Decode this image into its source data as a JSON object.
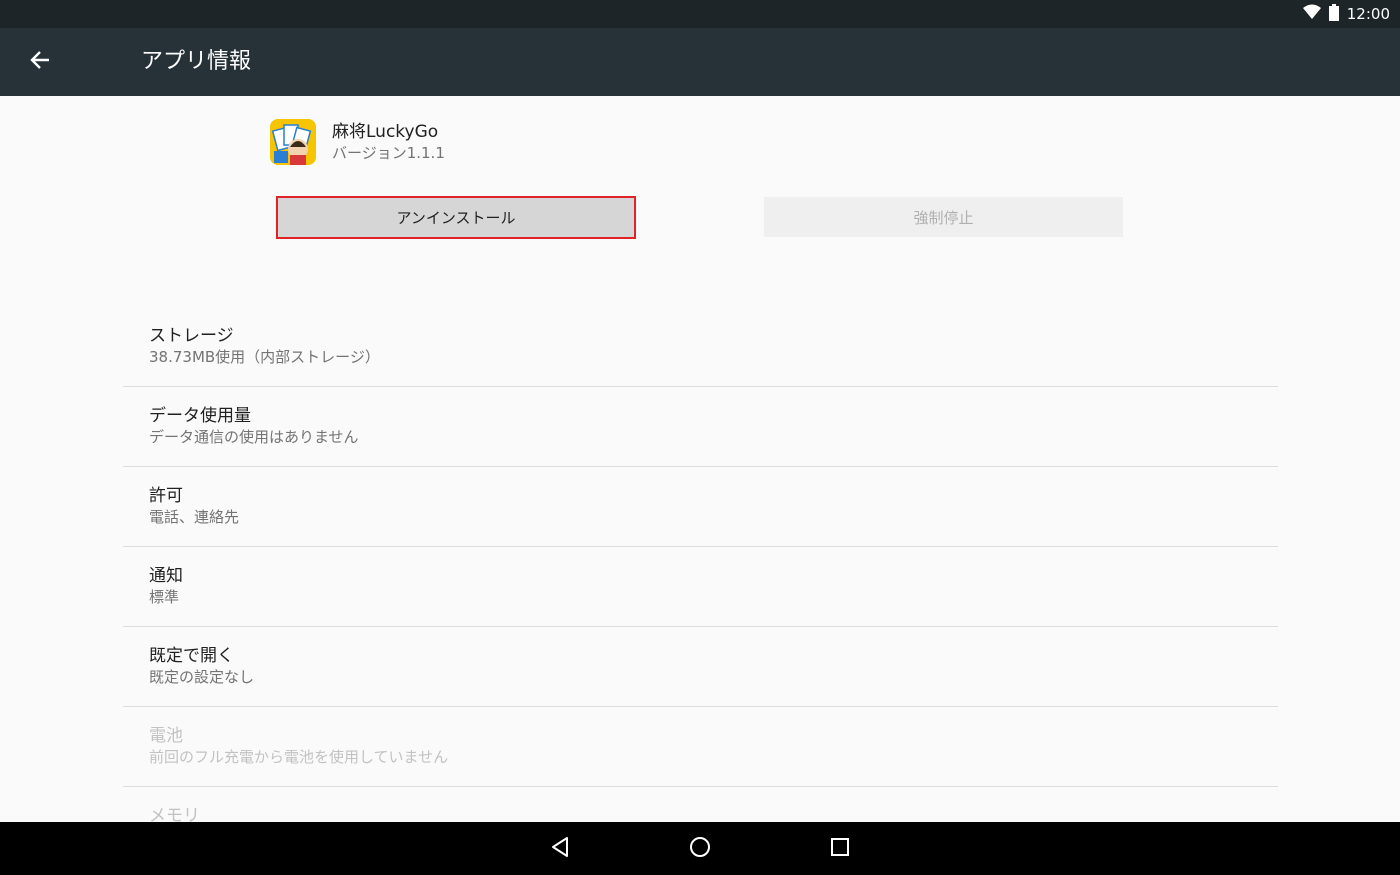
{
  "status_bar": {
    "time": "12:00",
    "icons": [
      "wifi-icon",
      "battery-icon"
    ]
  },
  "app_bar": {
    "back_icon": "arrow-left-icon",
    "title": "アプリ情報"
  },
  "app": {
    "name": "麻将LuckyGo",
    "version": "バージョン1.1.1"
  },
  "buttons": {
    "uninstall": "アンインストール",
    "force_stop": "強制停止"
  },
  "settings": [
    {
      "title": "ストレージ",
      "subtitle": "38.73MB使用（内部ストレージ）",
      "enabled": true
    },
    {
      "title": "データ使用量",
      "subtitle": "データ通信の使用はありません",
      "enabled": true
    },
    {
      "title": "許可",
      "subtitle": "電話、連絡先",
      "enabled": true
    },
    {
      "title": "通知",
      "subtitle": "標準",
      "enabled": true
    },
    {
      "title": "既定で開く",
      "subtitle": "既定の設定なし",
      "enabled": true
    },
    {
      "title": "電池",
      "subtitle": "前回のフル充電から電池を使用していません",
      "enabled": false
    },
    {
      "title": "メモリ",
      "subtitle": "",
      "enabled": false
    }
  ],
  "nav_bar": {
    "icons": [
      "back-triangle-icon",
      "home-circle-icon",
      "recents-square-icon"
    ]
  },
  "colors": {
    "app_bar": "#263238",
    "status_bar": "#1e2529",
    "highlight_border": "#e0222a"
  }
}
